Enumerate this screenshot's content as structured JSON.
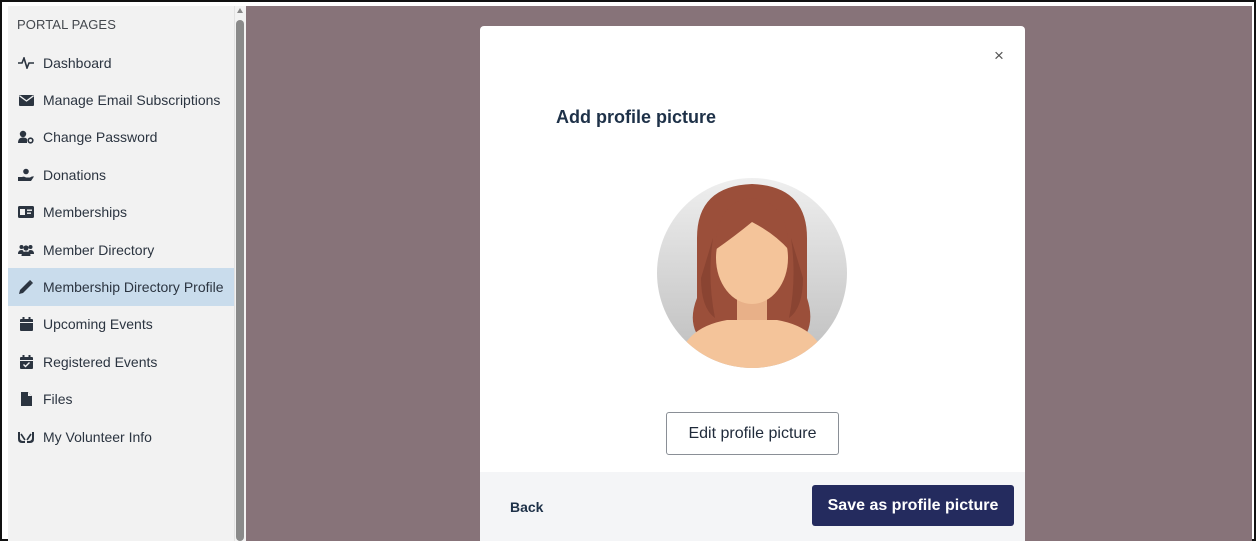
{
  "sidebar": {
    "heading": "PORTAL PAGES",
    "items": [
      {
        "label": "Dashboard",
        "icon": "heartbeat-icon"
      },
      {
        "label": "Manage Email Subscriptions",
        "icon": "envelope-icon"
      },
      {
        "label": "Change Password",
        "icon": "user-key-icon"
      },
      {
        "label": "Donations",
        "icon": "hand-holding-icon"
      },
      {
        "label": "Memberships",
        "icon": "id-card-icon"
      },
      {
        "label": "Member Directory",
        "icon": "users-icon"
      },
      {
        "label": "Membership Directory Profile",
        "icon": "pencil-icon",
        "active": true
      },
      {
        "label": "Upcoming Events",
        "icon": "calendar-icon"
      },
      {
        "label": "Registered Events",
        "icon": "calendar-check-icon"
      },
      {
        "label": "Files",
        "icon": "file-icon"
      },
      {
        "label": "My Volunteer Info",
        "icon": "hands-icon"
      }
    ]
  },
  "modal": {
    "close_label": "×",
    "title": "Add profile picture",
    "edit_button": "Edit profile picture",
    "back_link": "Back",
    "save_button": "Save as profile picture",
    "avatar_icon": "default-avatar-icon"
  },
  "colors": {
    "overlay": "#877379",
    "sidebar_bg": "#f2f2f2",
    "active_item": "#c9dcec",
    "primary_button": "#242b5e",
    "title_text": "#1e3148",
    "avatar_hair": "#9b4f3a",
    "avatar_skin": "#f4c49a"
  }
}
